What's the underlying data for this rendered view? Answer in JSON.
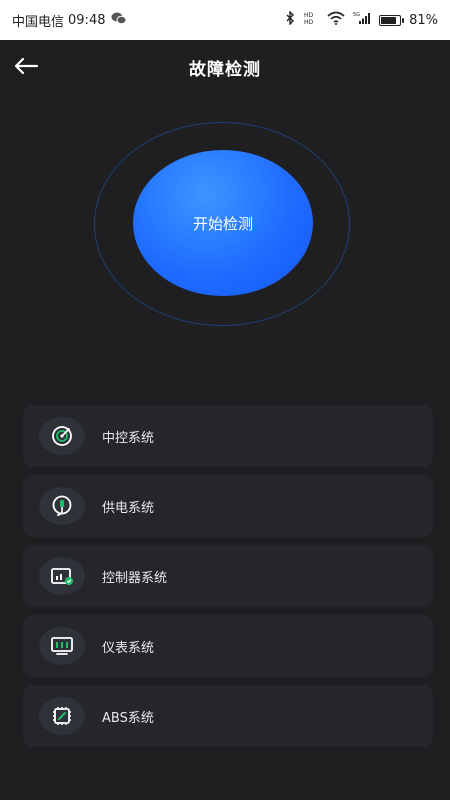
{
  "status_bar": {
    "carrier": "中国电信",
    "time": "09:48",
    "battery_percent": "81%",
    "battery_level": 0.81,
    "icons": [
      "wechat-icon",
      "bluetooth-icon",
      "hd-icon",
      "wifi-icon",
      "signal-5g-icon",
      "battery-icon"
    ]
  },
  "header": {
    "title": "故障检测",
    "back_icon": "back-arrow-icon"
  },
  "detect": {
    "button_label": "开始检测",
    "accent_color": "#1f6dff"
  },
  "systems": [
    {
      "label": "中控系统",
      "icon": "radar-icon"
    },
    {
      "label": "供电系统",
      "icon": "power-plug-icon"
    },
    {
      "label": "控制器系统",
      "icon": "controller-icon"
    },
    {
      "label": "仪表系统",
      "icon": "dashboard-icon"
    },
    {
      "label": "ABS系统",
      "icon": "chip-icon"
    }
  ],
  "colors": {
    "background": "#1f1f21",
    "card": "#25262b",
    "icon_green": "#1fbf6a"
  }
}
